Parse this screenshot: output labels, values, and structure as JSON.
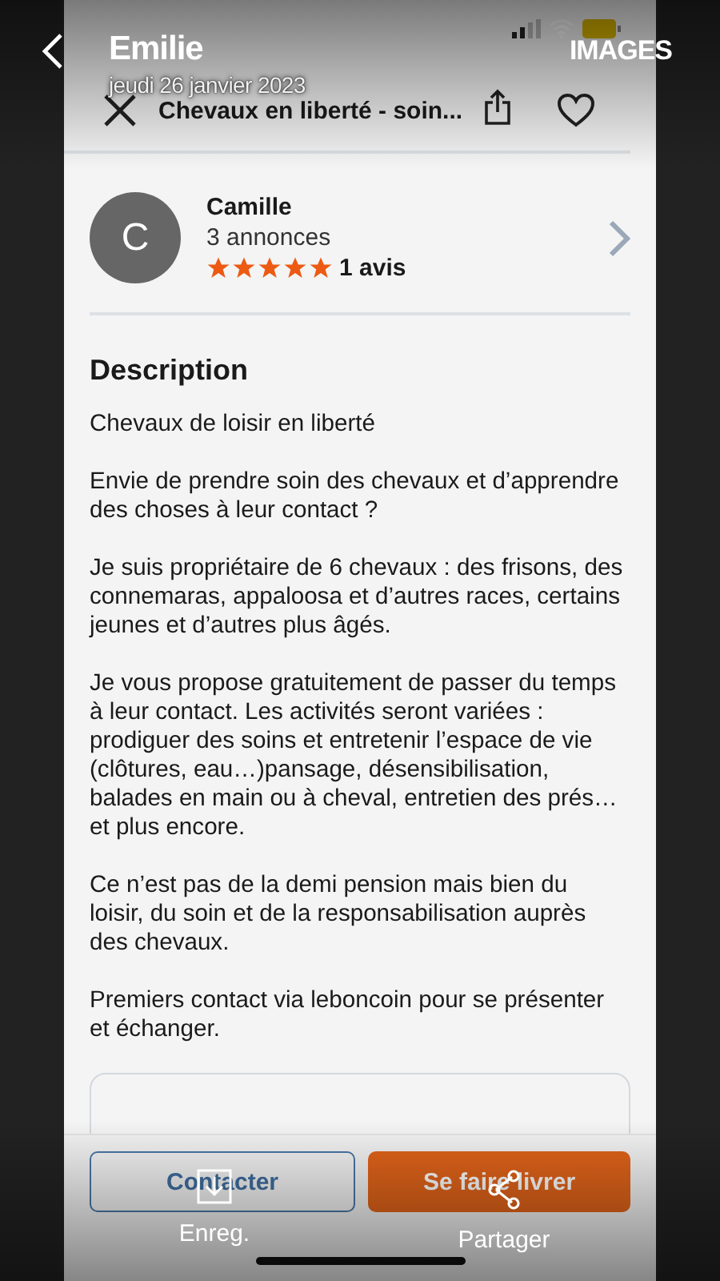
{
  "viewer": {
    "title": "Emilie",
    "date": "jeudi 26 janvier 2023",
    "album": "IMAGES",
    "actions": [
      {
        "label": "Enreg.",
        "kind": "save"
      },
      {
        "label": "Partager",
        "kind": "share"
      }
    ]
  },
  "ad": {
    "title": "Chevaux en liberté - soin...",
    "favorite": false,
    "seller": {
      "initial": "C",
      "name": "Camille",
      "listings": "3 annonces",
      "stars": 5,
      "reviews": "1 avis"
    },
    "description": {
      "heading": "Description",
      "paragraphs": [
        "Chevaux de loisir en liberté",
        "Envie de prendre soin des chevaux et d’apprendre des choses à leur contact ?",
        "Je suis propriétaire de 6 chevaux : des frisons, des connemaras, appaloosa et d’autres races, certains jeunes et d’autres plus âgés.",
        "Je vous propose gratuitement de passer du temps à leur contact. Les activités seront variées : prodiguer des soins et entretenir l’espace de vie (clôtures, eau…)pansage, désensibilisation, balades en main ou à cheval, entretien des prés… et plus encore.",
        "Ce n’est pas de la demi pension mais bien du loisir, du soin et de la responsabilisation auprès des chevaux.",
        "Premiers contact via leboncoin pour se présenter et échanger."
      ]
    },
    "buttons": [
      {
        "label": "Contacter",
        "kind": "outline"
      },
      {
        "label": "Se faire livrer",
        "kind": "primary"
      }
    ]
  }
}
